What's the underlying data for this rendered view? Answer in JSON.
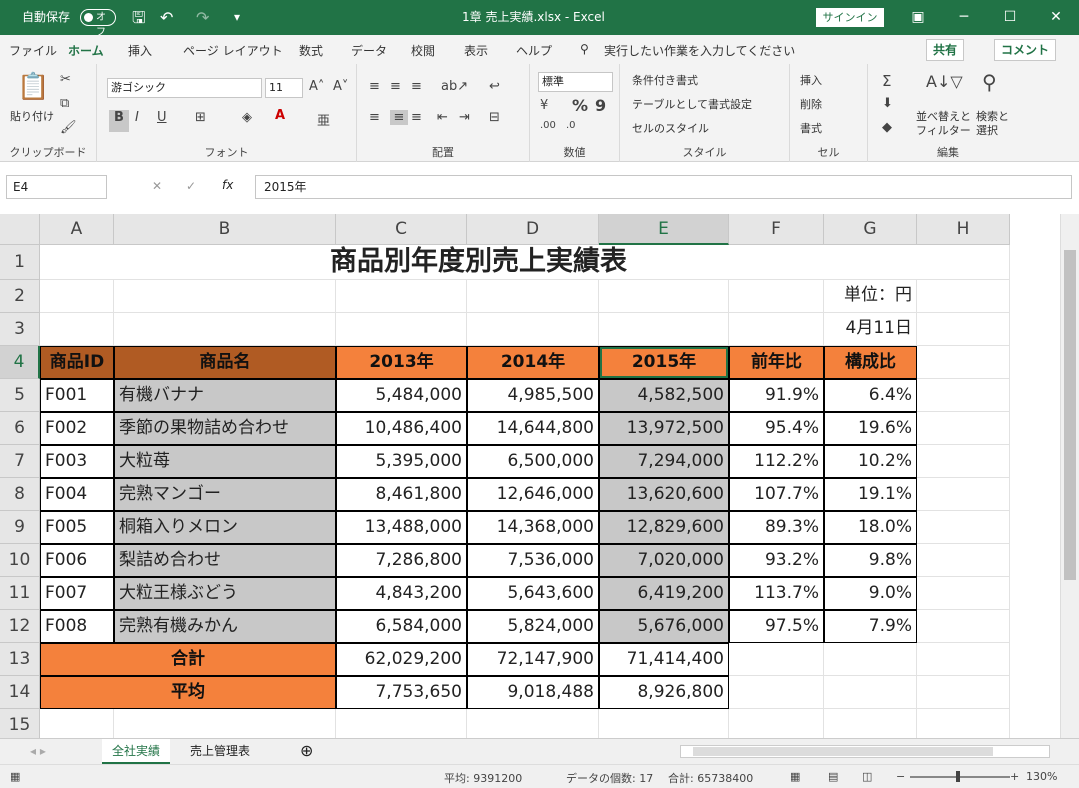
{
  "titlebar": {
    "autosave": "自動保存",
    "autosave_state": "オフ",
    "doc_title": "1章 売上実績.xlsx  -  Excel",
    "signin": "サインイン"
  },
  "ribbon_tabs": [
    "ファイル",
    "ホーム",
    "挿入",
    "ページ レイアウト",
    "数式",
    "データ",
    "校閲",
    "表示",
    "ヘルプ"
  ],
  "tell_me": "実行したい作業を入力してください",
  "share": "共有",
  "comment": "コメント",
  "ribbon": {
    "clipboard": {
      "label": "クリップボード",
      "paste": "貼り付け"
    },
    "font": {
      "label": "フォント",
      "name": "游ゴシック",
      "size": "11",
      "bold": "B",
      "italic": "I",
      "underline": "U"
    },
    "align": {
      "label": "配置"
    },
    "number": {
      "label": "数値",
      "format": "標準"
    },
    "style": {
      "label": "スタイル",
      "cond": "条件付き書式",
      "table": "テーブルとして書式設定",
      "cellstyle": "セルのスタイル"
    },
    "cells": {
      "label": "セル",
      "insert": "挿入",
      "delete": "削除",
      "format": "書式"
    },
    "edit": {
      "label": "編集",
      "sort": "並べ替えと",
      "sort2": "フィルター",
      "find": "検索と",
      "find2": "選択"
    }
  },
  "namebox": "E4",
  "formula": "2015年",
  "columns": [
    "A",
    "B",
    "C",
    "D",
    "E",
    "F",
    "G",
    "H"
  ],
  "rows": [
    "1",
    "2",
    "3",
    "4",
    "5",
    "6",
    "7",
    "8",
    "9",
    "10",
    "11",
    "12",
    "13",
    "14",
    "15"
  ],
  "sheet": {
    "title": "商品別年度別売上実績表",
    "unit": "単位：円",
    "date": "4月11日",
    "headers": [
      "商品ID",
      "商品名",
      "2013年",
      "2014年",
      "2015年",
      "前年比",
      "構成比"
    ],
    "data": [
      [
        "F001",
        "有機バナナ",
        "5,484,000",
        "4,985,500",
        "4,582,500",
        "91.9%",
        "6.4%"
      ],
      [
        "F002",
        "季節の果物詰め合わせ",
        "10,486,400",
        "14,644,800",
        "13,972,500",
        "95.4%",
        "19.6%"
      ],
      [
        "F003",
        "大粒苺",
        "5,395,000",
        "6,500,000",
        "7,294,000",
        "112.2%",
        "10.2%"
      ],
      [
        "F004",
        "完熟マンゴー",
        "8,461,800",
        "12,646,000",
        "13,620,600",
        "107.7%",
        "19.1%"
      ],
      [
        "F005",
        "桐箱入りメロン",
        "13,488,000",
        "14,368,000",
        "12,829,600",
        "89.3%",
        "18.0%"
      ],
      [
        "F006",
        "梨詰め合わせ",
        "7,286,800",
        "7,536,000",
        "7,020,000",
        "93.2%",
        "9.8%"
      ],
      [
        "F007",
        "大粒王様ぶどう",
        "4,843,200",
        "5,643,600",
        "6,419,200",
        "113.7%",
        "9.0%"
      ],
      [
        "F008",
        "完熟有機みかん",
        "6,584,000",
        "5,824,000",
        "5,676,000",
        "97.5%",
        "7.9%"
      ]
    ],
    "total": {
      "label": "合計",
      "values": [
        "62,029,200",
        "72,147,900",
        "71,414,400"
      ]
    },
    "average": {
      "label": "平均",
      "values": [
        "7,753,650",
        "9,018,488",
        "8,926,800"
      ]
    }
  },
  "sheet_tabs": [
    "全社実績",
    "売上管理表"
  ],
  "status": {
    "avg": "平均: 9391200",
    "count": "データの個数: 17",
    "sum": "合計: 65738400",
    "zoom": "130%"
  }
}
